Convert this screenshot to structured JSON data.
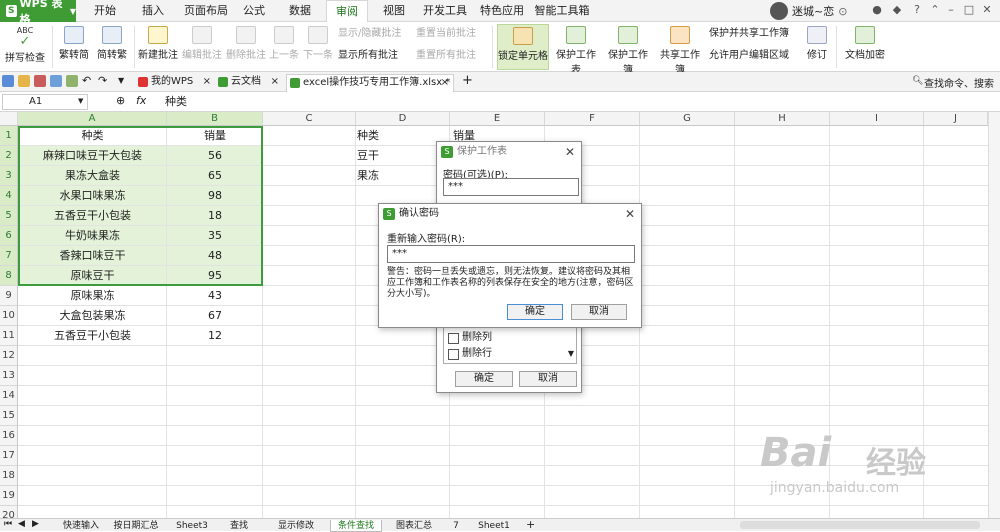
{
  "app": {
    "name": "WPS 表格",
    "logo": "S"
  },
  "menu": [
    "开始",
    "插入",
    "页面布局",
    "公式",
    "数据",
    "审阅",
    "视图",
    "开发工具",
    "特色应用",
    "智能工具箱"
  ],
  "menu_active": "审阅",
  "user": {
    "name": "迷城~恋"
  },
  "ribbon": {
    "spellcheck": "拼写检查",
    "spellcheck_top": "ABC",
    "trad_to_simp": "繁转简",
    "simp_to_trad": "简转繁",
    "new_comment": "新建批注",
    "edit_comment": "编辑批注",
    "delete_comment": "删除批注",
    "prev": "上一条",
    "next": "下一条",
    "show_hide_comment": "显示/隐藏批注",
    "show_all_comments": "显示所有批注",
    "reset_current_comment": "重置当前批注",
    "reset_all_comments": "重置所有批注",
    "lock_cell": "锁定单元格",
    "protect_sheet": "保护工作表",
    "protect_workbook": "保护工作簿",
    "share_workbook": "共享工作簿",
    "protect_share_workbook": "保护并共享工作簿",
    "allow_edit_ranges": "允许用户编辑区域",
    "revise": "修订",
    "doc_encrypt": "文档加密"
  },
  "tabs": [
    {
      "label": "我的WPS",
      "close": "×"
    },
    {
      "label": "云文档",
      "close": "×"
    },
    {
      "label": "excel操作技巧专用工作簿.xlsx *",
      "close": "×"
    }
  ],
  "tab_add": "+",
  "search_cmd": "查找命令、搜索",
  "formula_bar": {
    "cell_ref": "A1",
    "fx": "fx",
    "content": "种类"
  },
  "columns": [
    "A",
    "B",
    "C",
    "D",
    "E",
    "F",
    "G",
    "H",
    "I",
    "J"
  ],
  "rows": [
    "1",
    "2",
    "3",
    "4",
    "5",
    "6",
    "7",
    "8",
    "9",
    "10",
    "11",
    "12",
    "13",
    "14",
    "15",
    "16",
    "17",
    "18",
    "19",
    "20"
  ],
  "table": {
    "headers": [
      "种类",
      "销量"
    ],
    "rows": [
      [
        "麻辣口味豆干大包装",
        "56"
      ],
      [
        "果冻大盒装",
        "65"
      ],
      [
        "水果口味果冻",
        "98"
      ],
      [
        "五香豆干小包装",
        "18"
      ],
      [
        "牛奶味果冻",
        "35"
      ],
      [
        "香辣口味豆干",
        "48"
      ],
      [
        "原味豆干",
        "95"
      ],
      [
        "原味果冻",
        "43"
      ],
      [
        "大盒包装果冻",
        "67"
      ],
      [
        "五香豆干小包装",
        "12"
      ]
    ]
  },
  "side_table": {
    "headers": [
      "种类",
      "销量"
    ],
    "rows": [
      "豆干",
      "果冻"
    ]
  },
  "protect_dialog": {
    "title": "保护工作表",
    "password_label": "密码(可选)(P):",
    "password_value": "***",
    "options": [
      "删除列",
      "删除行"
    ],
    "ok": "确定",
    "cancel": "取消"
  },
  "confirm_dialog": {
    "title": "确认密码",
    "label": "重新输入密码(R):",
    "value": "***",
    "warning": "警告：密码一旦丢失或遗忘，则无法恢复。建议将密码及其相应工作簿和工作表名称的列表保存在安全的地方(注意，密码区分大小写)。",
    "ok": "确定",
    "cancel": "取消"
  },
  "sheets": [
    "快速输入",
    "按日期汇总",
    "Sheet3",
    "查找",
    "显示修改",
    "条件查找",
    "图表汇总",
    "7",
    "Sheet1"
  ],
  "sheet_active": "条件查找",
  "sheet_add": "+",
  "watermark": {
    "main": "Bai",
    "cn": "经验",
    "url": "jingyan.baidu.com"
  }
}
